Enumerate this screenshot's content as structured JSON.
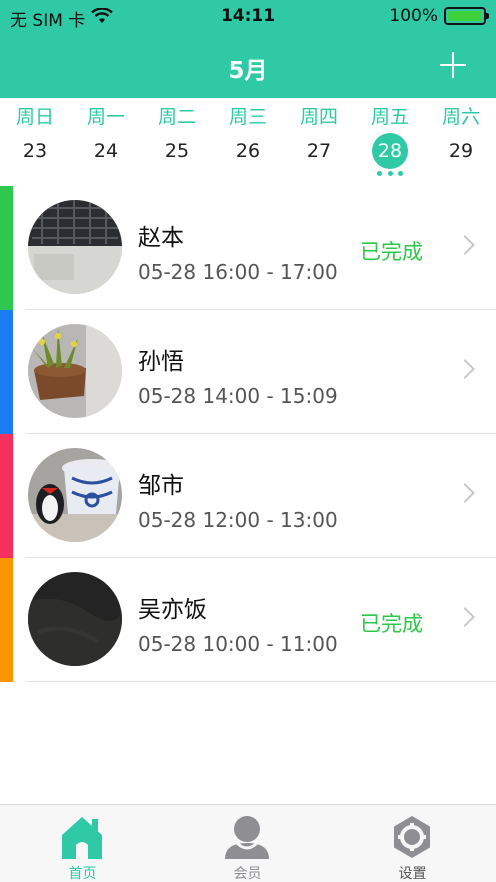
{
  "status_bar": {
    "carrier": "无 SIM 卡",
    "time": "14:11",
    "battery": "100%",
    "battery_level": 1.0
  },
  "nav": {
    "title": "5月",
    "add_icon": "plus-icon"
  },
  "week": {
    "days": [
      {
        "weekday": "周日",
        "date": "23"
      },
      {
        "weekday": "周一",
        "date": "24"
      },
      {
        "weekday": "周二",
        "date": "25"
      },
      {
        "weekday": "周三",
        "date": "26"
      },
      {
        "weekday": "周四",
        "date": "27"
      },
      {
        "weekday": "周五",
        "date": "28"
      },
      {
        "weekday": "周六",
        "date": "29"
      }
    ],
    "selected_date": "28"
  },
  "appointments": [
    {
      "name": "赵本",
      "time": "05-28 16:00 - 17:00",
      "status": "已完成",
      "stripe_color": "#2ec84e"
    },
    {
      "name": "孙悟",
      "time": "05-28 14:00 - 15:09",
      "status": "",
      "stripe_color": "#1a7cf5"
    },
    {
      "name": "邹市",
      "time": "05-28 12:00 - 13:00",
      "status": "",
      "stripe_color": "#f5305e"
    },
    {
      "name": "吴亦饭",
      "time": "05-28 10:00 - 11:00",
      "status": "已完成",
      "stripe_color": "#fb9500"
    }
  ],
  "tabs": [
    {
      "label": "首页",
      "icon": "home-icon",
      "active": true
    },
    {
      "label": "会员",
      "icon": "member-icon",
      "active": false
    },
    {
      "label": "设置",
      "icon": "settings-icon",
      "active": false
    }
  ],
  "colors": {
    "accent": "#2fc9a6",
    "done": "#2dc84a",
    "tab_inactive": "#8e8e93"
  }
}
